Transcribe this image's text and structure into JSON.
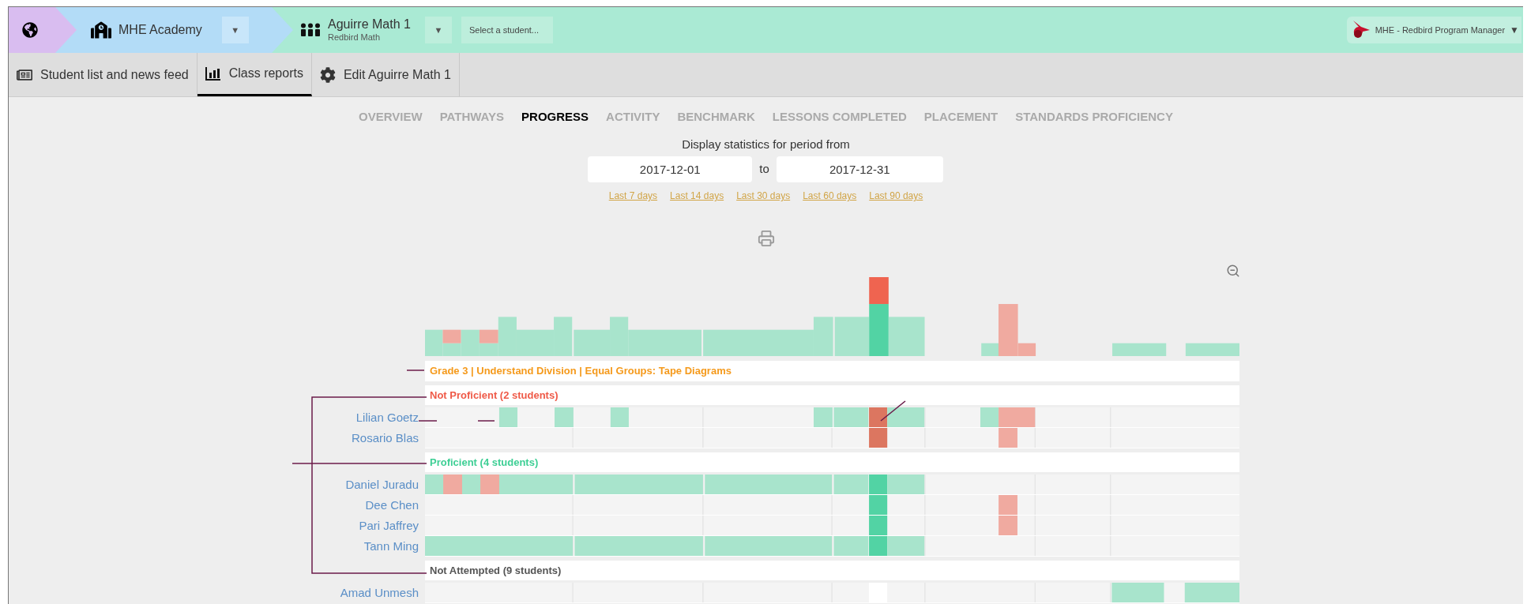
{
  "breadcrumb": {
    "school": "MHE Academy",
    "school_caret": "▼",
    "class_name": "Aguirre Math 1",
    "class_subtitle": "Redbird Math",
    "class_caret": "▼",
    "student_select": {
      "placeholder": "Select a student..."
    }
  },
  "account": {
    "label": "MHE - Redbird Program Manager",
    "caret": "▼"
  },
  "tabs": [
    {
      "kind": "feed",
      "label": "Student list and news feed",
      "selected": false
    },
    {
      "kind": "reports",
      "label": "Class reports",
      "selected": true
    },
    {
      "kind": "edit",
      "label": "Edit Aguirre Math 1",
      "selected": false
    }
  ],
  "report_tabs": [
    {
      "label": "OVERVIEW",
      "selected": false
    },
    {
      "label": "PATHWAYS",
      "selected": false
    },
    {
      "label": "PROGRESS",
      "selected": true
    },
    {
      "label": "ACTIVITY",
      "selected": false
    },
    {
      "label": "BENCHMARK",
      "selected": false
    },
    {
      "label": "LESSONS COMPLETED",
      "selected": false
    },
    {
      "label": "PLACEMENT",
      "selected": false
    },
    {
      "label": "STANDARDS PROFICIENCY",
      "selected": false
    }
  ],
  "period": {
    "label": "Display statistics for period from",
    "from": "2017-12-01",
    "separator": "to",
    "to": "2017-12-31",
    "presets": [
      "Last 7 days",
      "Last 14 days",
      "Last 30 days",
      "Last 60 days",
      "Last 90 days"
    ]
  },
  "topic": "Grade 3 | Understand Division | Equal Groups: Tape Diagrams",
  "groups": [
    {
      "kind": "not_proficient",
      "label": "Not Proficient (2 students)",
      "students": [
        {
          "name": "Lilian Goetz"
        },
        {
          "name": "Rosario Blas"
        }
      ]
    },
    {
      "kind": "proficient",
      "label": "Proficient (4 students)",
      "students": [
        {
          "name": "Daniel Juradu"
        },
        {
          "name": "Dee Chen"
        },
        {
          "name": "Pari Jaffrey"
        },
        {
          "name": "Tann Ming"
        }
      ]
    },
    {
      "kind": "not_attempted",
      "label": "Not Attempted (9 students)",
      "students": [
        {
          "name": "Amad Unmesh"
        }
      ]
    }
  ]
}
